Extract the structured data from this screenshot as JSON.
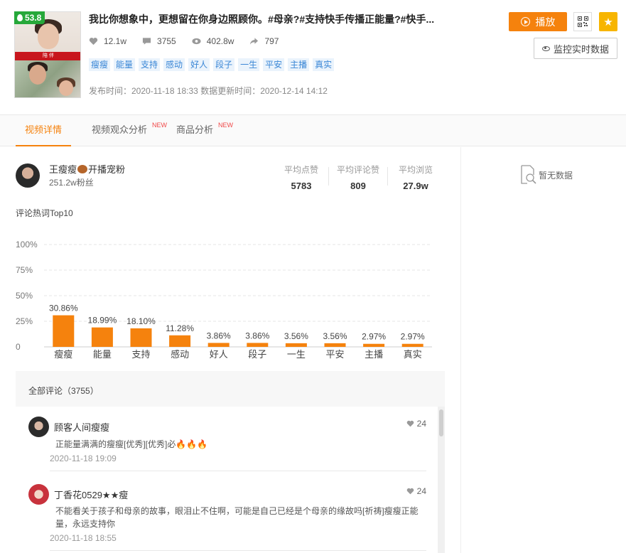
{
  "video": {
    "score": "53.8",
    "title": "我比你想象中，更想留在你身边照顾你。#母亲?#支持快手传播正能量?#快手...",
    "stats": {
      "likes": "12.1w",
      "comments": "3755",
      "views": "402.8w",
      "shares": "797"
    },
    "tags": [
      "瘦瘦",
      "能量",
      "支持",
      "感动",
      "好人",
      "段子",
      "一生",
      "平安",
      "主播",
      "真实"
    ],
    "publish_time": "发布时间：2020-11-18 18:33 数据更新时间：2020-12-14 14:12",
    "thumb_text": "陪 伴"
  },
  "actions": {
    "play_label": "播放",
    "monitor_label": "监控实时数据"
  },
  "tabs": [
    {
      "label": "视频详情",
      "new": ""
    },
    {
      "label": "视频观众分析",
      "new": "NEW"
    },
    {
      "label": "商品分析",
      "new": "NEW"
    }
  ],
  "author": {
    "name": "王瘦瘦",
    "badge": "开播宠粉",
    "fans": "251.2w粉丝",
    "avg_likes_label": "平均点赞",
    "avg_likes": "5783",
    "avg_comment_likes_label": "平均评论赞",
    "avg_comment_likes": "809",
    "avg_views_label": "平均浏览",
    "avg_views": "27.9w"
  },
  "chart_title": "评论热词Top10",
  "chart_data": {
    "type": "bar",
    "categories": [
      "瘦瘦",
      "能量",
      "支持",
      "感动",
      "好人",
      "段子",
      "一生",
      "平安",
      "主播",
      "真实"
    ],
    "values": [
      30.86,
      18.99,
      18.1,
      11.28,
      3.86,
      3.86,
      3.56,
      3.56,
      2.97,
      2.97
    ],
    "data_labels": [
      "30.86%",
      "18.99%",
      "18.10%",
      "11.28%",
      "3.86%",
      "3.86%",
      "3.56%",
      "3.56%",
      "2.97%",
      "2.97%"
    ],
    "ytick_labels": [
      "0",
      "25%",
      "50%",
      "75%",
      "100%"
    ],
    "yticks": [
      0,
      25,
      50,
      75,
      100
    ],
    "ylim": [
      0,
      100
    ],
    "color": "#f5820d",
    "grid": true
  },
  "comments": {
    "header": "全部评论（3755）",
    "items": [
      {
        "name": "顾客人间瘦瘦",
        "likes": "24",
        "text": "正能量满满的瘦瘦[优秀][优秀]必🔥🔥🔥",
        "time": "2020-11-18 19:09"
      },
      {
        "name": "丁香花0529★★瘦",
        "likes": "24",
        "text": "不能看关于孩子和母亲的故事，眼泪止不住啊，可能是自己已经是个母亲的缘故吗[祈祷]瘦瘦正能量，永远支持你",
        "time": "2020-11-18 18:55"
      }
    ]
  },
  "right_panel": {
    "empty_text": "暂无数据"
  },
  "colors": {
    "accent": "#f5820d",
    "tag_bg": "#eaf3fc",
    "tag_text": "#3b87d6",
    "score_green": "#26a83a",
    "star_yellow": "#f7b500"
  }
}
